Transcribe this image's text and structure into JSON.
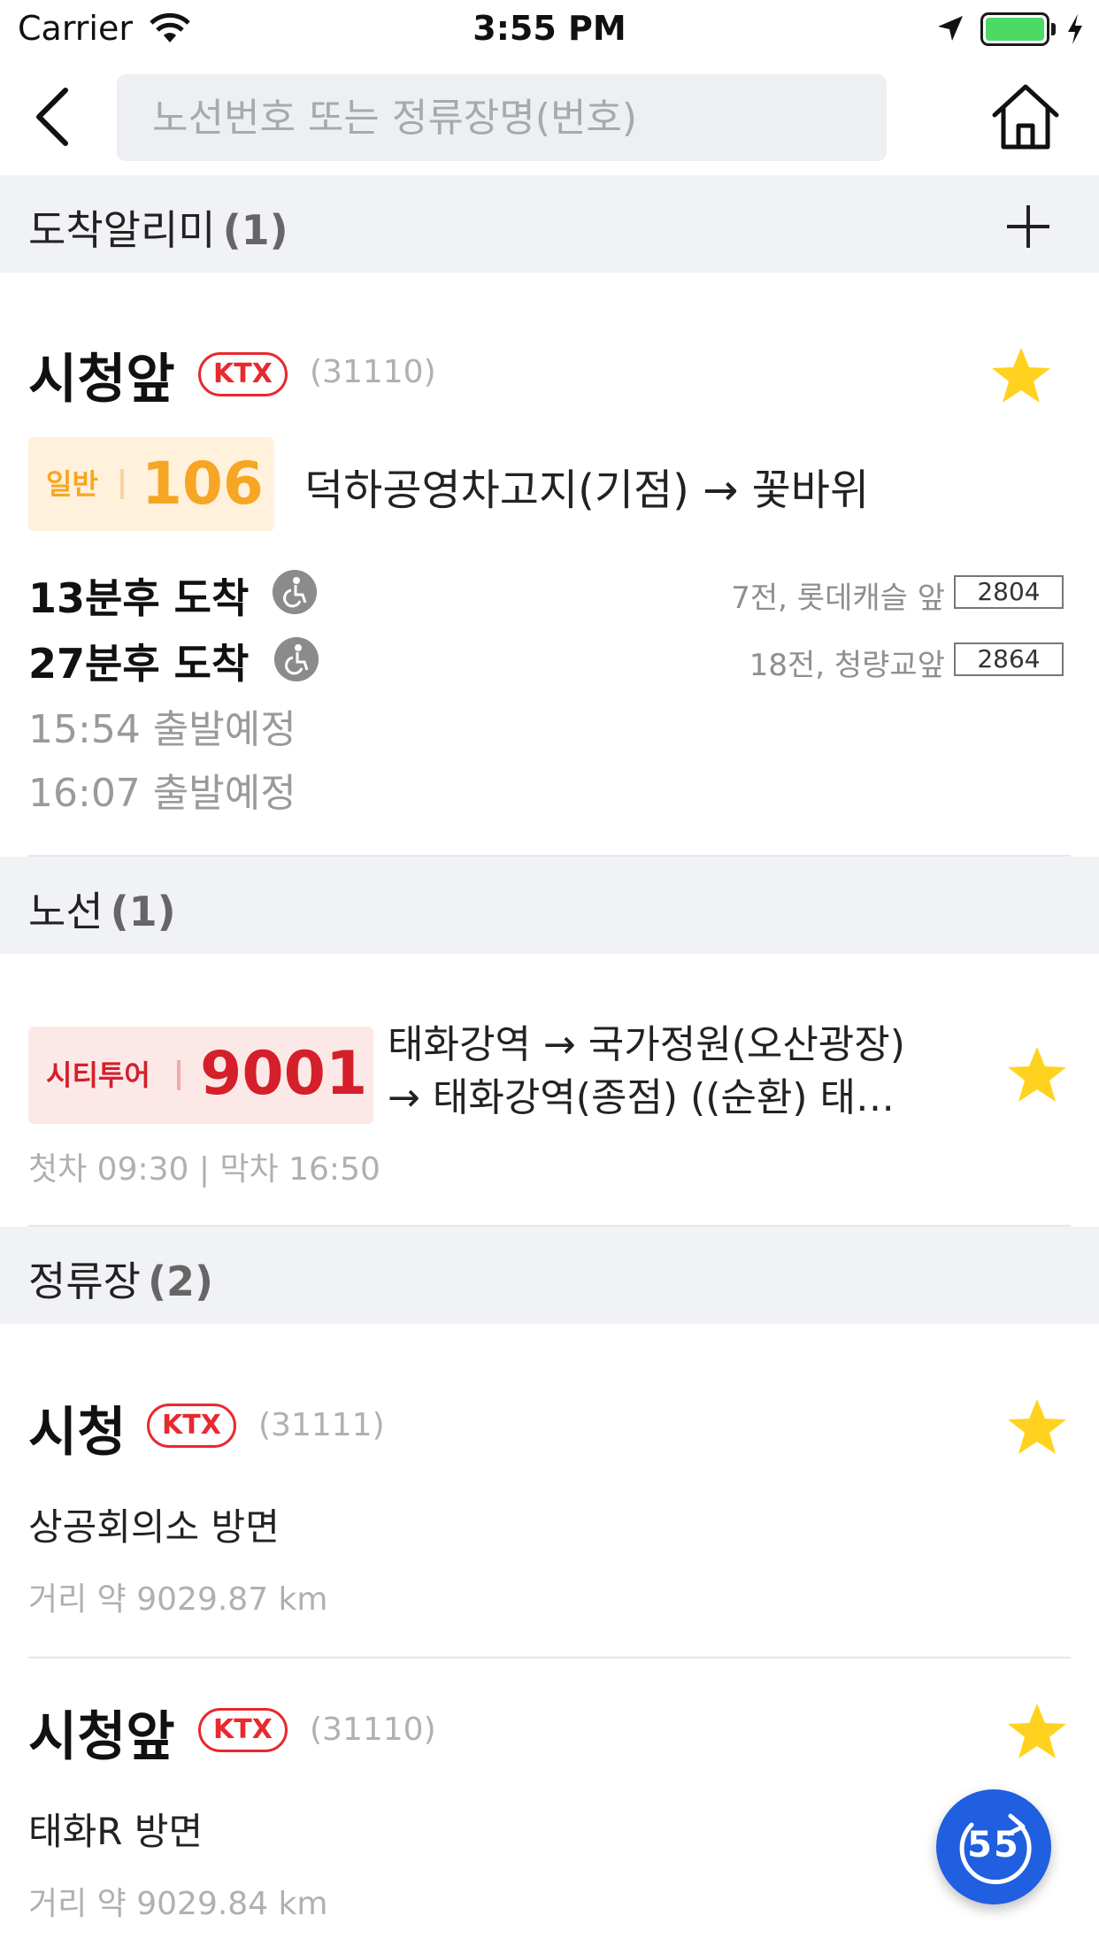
{
  "status_bar": {
    "carrier": "Carrier",
    "time": "3:55 PM",
    "battery_color": "#4cd964"
  },
  "nav": {
    "back_icon": "chevron-left-icon",
    "search_placeholder": "노선번호 또는 정류장명(번호)",
    "home_icon": "home-icon"
  },
  "alarm_section": {
    "title": "도착알리미",
    "count": "(1)",
    "add_icon": "plus-icon",
    "stop": {
      "name": "시청앞",
      "badge": "KTX",
      "code": "(31110)",
      "favorited": true
    },
    "bus": {
      "type": "일반",
      "number": "106",
      "route": "덕하공영차고지(기점) → 꽃바위",
      "accent": "#f6a623",
      "badge_bg": "#fff1dc"
    },
    "arrivals": [
      {
        "time": "13분후 도착",
        "position": "7전, 롯데캐슬 앞",
        "plate": "2804"
      },
      {
        "time": "27분후 도착",
        "position": "18전, 청량교앞",
        "plate": "2864"
      }
    ],
    "departures": [
      "15:54 출발예정",
      "16:07 출발예정"
    ]
  },
  "route_section": {
    "title": "노선",
    "count": "(1)",
    "route": {
      "type": "시티투어",
      "number": "9001",
      "desc_line1": "태화강역 → 국가정원(오산광장)",
      "desc_line2": "→ 태화강역(종점) ((순환) 태…",
      "times": "첫차 09:30  |  막차 16:50",
      "accent": "#d51f2a",
      "badge_bg": "#fde8e8",
      "favorited": true
    }
  },
  "stop_section": {
    "title": "정류장",
    "count": "(2)",
    "stops": [
      {
        "name": "시청",
        "badge": "KTX",
        "code": "(31111)",
        "direction": "상공회의소 방면",
        "distance": "거리 약 9029.87 km",
        "favorited": true
      },
      {
        "name": "시청앞",
        "badge": "KTX",
        "code": "(31110)",
        "direction": "태화R 방면",
        "distance": "거리 약 9029.84 km",
        "favorited": true
      }
    ]
  },
  "fab": {
    "label": "55",
    "icon": "refresh-icon",
    "color": "#1f5fe0"
  },
  "colors": {
    "star": "#ffd21f",
    "ktx": "#e8292f"
  }
}
